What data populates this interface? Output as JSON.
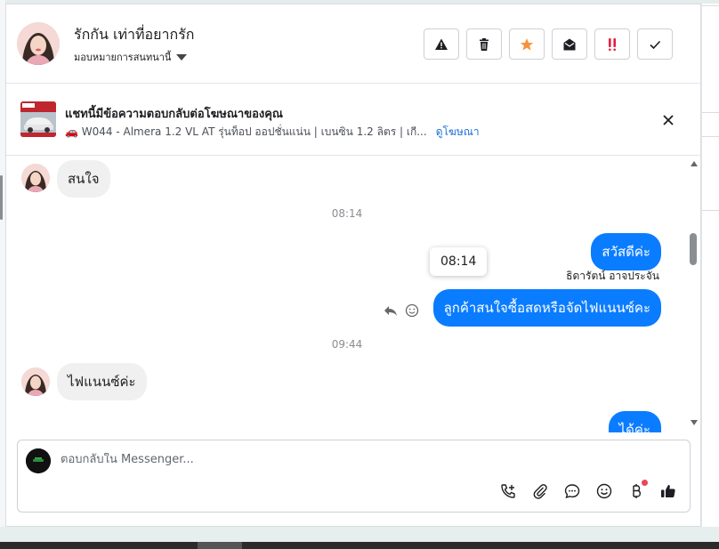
{
  "header": {
    "contact_name": "รักกัน เท่าที่อยากรัก",
    "assign_label": "มอบหมายการสนทนานี้",
    "actions": [
      {
        "icon": "warning-icon",
        "color": "#1c1e21"
      },
      {
        "icon": "trash-icon",
        "color": "#1c1e21"
      },
      {
        "icon": "star-icon",
        "color": "#f7923a"
      },
      {
        "icon": "envelope-open-icon",
        "color": "#1c1e21"
      },
      {
        "icon": "double-exclamation-icon",
        "color": "#e41e3f"
      },
      {
        "icon": "check-icon",
        "color": "#1c1e21"
      }
    ]
  },
  "ad_banner": {
    "title": "แชทนี้มีข้อความตอบกลับต่อโฆษณาของคุณ",
    "subtitle": "🚗 W044 - Almera 1.2 VL AT รุ่นท็อป ออปชั่นแน่น | เบนซิน 1.2 ลิตร | เกี...",
    "link": "ดูโฆษณา"
  },
  "conversation": {
    "msg1": "สนใจ",
    "time1": "08:14",
    "msg2": "สวัสดีค่ะ",
    "tooltip_time": "08:14",
    "sender_name": "ธิดารัตน์ อาจประจัน",
    "msg3": "ลูกค้าสนใจซื้อสดหรือจัดไฟแนนซ์คะ",
    "time2": "09:44",
    "msg4": "ไฟแนนซ์ค่ะ",
    "msg5": "ได้ค่ะ"
  },
  "composer": {
    "placeholder": "ตอบกลับใน Messenger...",
    "tools": [
      "add-call-icon",
      "paperclip-icon",
      "chat-bubble-icon",
      "emoji-icon",
      "baht-icon",
      "thumbs-up-icon"
    ]
  },
  "colors": {
    "outgoing_bubble": "#0a7cff",
    "incoming_bubble": "#f0f0f0",
    "link": "#1a6fd6",
    "notification_dot": "#e8465d"
  }
}
